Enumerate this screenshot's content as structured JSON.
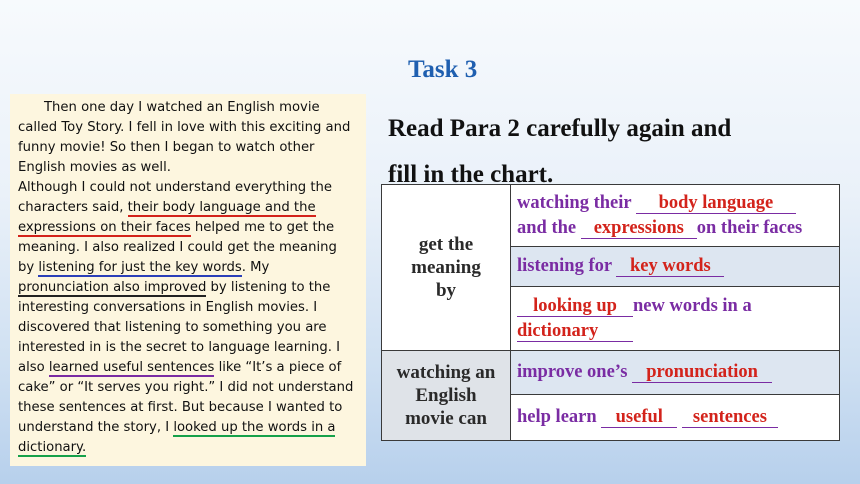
{
  "task_title": "Task 3",
  "passage": {
    "p1_a": "Then one day I watched an English movie called Toy Story. I fell in love with this exciting and funny movie! So then I began to watch other English movies as well.",
    "p2_a": "Although I could not understand everything the characters said, ",
    "p2_u1": "their body language and the expressions on their faces",
    "p2_b": " helped me to get the meaning. I also realized I could get the meaning by ",
    "p2_u2": "listening for just the key words",
    "p2_c": ". My ",
    "p2_u3": "pronunciation also improved",
    "p2_d": " by listening to the interesting conversations in English movies. I discovered that listening to something you are interested in is the secret to language learning. I also ",
    "p2_u4": "learned useful sentences",
    "p2_e": " like “It’s a piece of cake” or “It serves you right.” I did not understand these sentences at first. But because I wanted to understand the story, I ",
    "p2_u5": "looked up the words in a dictionary."
  },
  "instruction": {
    "line1": "Read Para 2 carefully again and",
    "line2": "fill in the chart."
  },
  "chart": {
    "label1": [
      "get the",
      "meaning",
      "by"
    ],
    "label2": [
      "watching an",
      "English",
      "movie can"
    ],
    "row1": {
      "pre": "watching their ",
      "ans1": "body language",
      "mid": "and the ",
      "ans2": "expressions",
      "post": "on their faces"
    },
    "row2": {
      "pre": "listening for ",
      "ans": "key words"
    },
    "row3": {
      "ans1": "looking up",
      "mid": "new words in a",
      "ans2": "dictionary"
    },
    "row4": {
      "pre": "improve one’s ",
      "ans": "pronunciation"
    },
    "row5": {
      "pre": "help learn ",
      "ans1": "useful",
      "ans2": "sentences"
    }
  }
}
